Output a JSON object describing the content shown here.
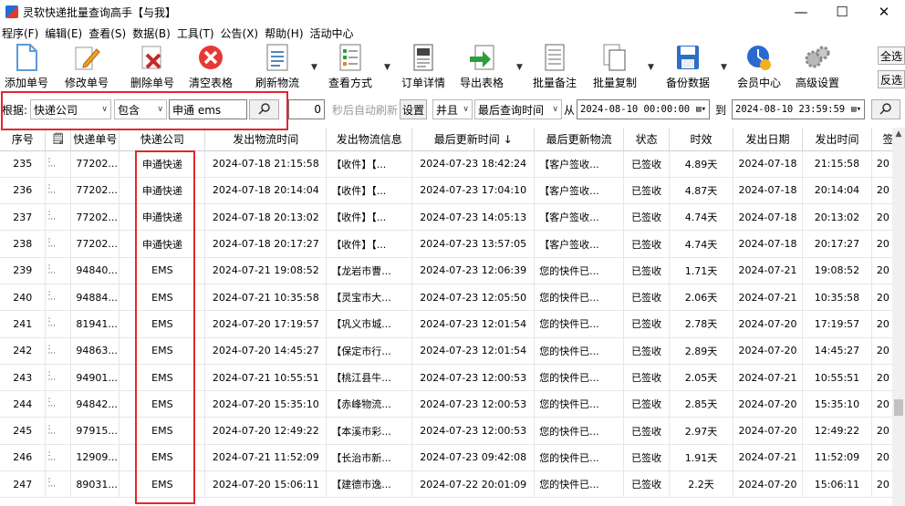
{
  "window": {
    "title": "灵软快递批量查询高手【与我】",
    "minimize": "—",
    "maximize": "☐",
    "close": "✕"
  },
  "menu": [
    "程序(F)",
    "编辑(E)",
    "查看(S)",
    "数据(B)",
    "工具(T)",
    "公告(X)",
    "帮助(H)",
    "活动中心"
  ],
  "toolbar": {
    "add": "添加单号",
    "edit": "修改单号",
    "delete": "删除单号",
    "clear": "清空表格",
    "refresh": "刷新物流",
    "view": "查看方式",
    "detail": "订单详情",
    "export": "导出表格",
    "remark": "批量备注",
    "copy": "批量复制",
    "backup": "备份数据",
    "member": "会员中心",
    "advanced": "高级设置",
    "select_all": "全选",
    "invert": "反选"
  },
  "filter": {
    "basis_label": "根据:",
    "field": "快递公司",
    "operator": "包含",
    "keyword": "申通 ems",
    "auto_refresh_value": "0",
    "auto_refresh_label": "秒后自动刷新",
    "settings": "设置",
    "logic": "并且",
    "time_field": "最后查询时间",
    "from_label": "从",
    "from": "2024-08-10 00:00:00",
    "to_label": "到",
    "to": "2024-08-10 23:59:59"
  },
  "table": {
    "columns": [
      "序号",
      "🗒",
      "快递单号",
      "快递公司",
      "发出物流时间",
      "发出物流信息",
      "最后更新时间 ↓",
      "最后更新物流",
      "状态",
      "时效",
      "发出日期",
      "发出时间",
      "签"
    ],
    "rows": [
      [
        "235",
        "77202...",
        "申通快递",
        "2024-07-18 21:15:58",
        "【收件】【...",
        "2024-07-23 18:42:24",
        "【客户签收...",
        "已签收",
        "4.89天",
        "2024-07-18",
        "21:15:58",
        "20"
      ],
      [
        "236",
        "77202...",
        "申通快递",
        "2024-07-18 20:14:04",
        "【收件】【...",
        "2024-07-23 17:04:10",
        "【客户签收...",
        "已签收",
        "4.87天",
        "2024-07-18",
        "20:14:04",
        "20"
      ],
      [
        "237",
        "77202...",
        "申通快递",
        "2024-07-18 20:13:02",
        "【收件】【...",
        "2024-07-23 14:05:13",
        "【客户签收...",
        "已签收",
        "4.74天",
        "2024-07-18",
        "20:13:02",
        "20"
      ],
      [
        "238",
        "77202...",
        "申通快递",
        "2024-07-18 20:17:27",
        "【收件】【...",
        "2024-07-23 13:57:05",
        "【客户签收...",
        "已签收",
        "4.74天",
        "2024-07-18",
        "20:17:27",
        "20"
      ],
      [
        "239",
        "94840...",
        "EMS",
        "2024-07-21 19:08:52",
        "【龙岩市曹...",
        "2024-07-23 12:06:39",
        "您的快件已...",
        "已签收",
        "1.71天",
        "2024-07-21",
        "19:08:52",
        "20"
      ],
      [
        "240",
        "94884...",
        "EMS",
        "2024-07-21 10:35:58",
        "【灵宝市大...",
        "2024-07-23 12:05:50",
        "您的快件已...",
        "已签收",
        "2.06天",
        "2024-07-21",
        "10:35:58",
        "20"
      ],
      [
        "241",
        "81941...",
        "EMS",
        "2024-07-20 17:19:57",
        "【巩义市城...",
        "2024-07-23 12:01:54",
        "您的快件已...",
        "已签收",
        "2.78天",
        "2024-07-20",
        "17:19:57",
        "20"
      ],
      [
        "242",
        "94863...",
        "EMS",
        "2024-07-20 14:45:27",
        "【保定市行...",
        "2024-07-23 12:01:54",
        "您的快件已...",
        "已签收",
        "2.89天",
        "2024-07-20",
        "14:45:27",
        "20"
      ],
      [
        "243",
        "94901...",
        "EMS",
        "2024-07-21 10:55:51",
        "【桃江县牛...",
        "2024-07-23 12:00:53",
        "您的快件已...",
        "已签收",
        "2.05天",
        "2024-07-21",
        "10:55:51",
        "20"
      ],
      [
        "244",
        "94842...",
        "EMS",
        "2024-07-20 15:35:10",
        "【赤峰物流...",
        "2024-07-23 12:00:53",
        "您的快件已...",
        "已签收",
        "2.85天",
        "2024-07-20",
        "15:35:10",
        "20"
      ],
      [
        "245",
        "97915...",
        "EMS",
        "2024-07-20 12:49:22",
        "【本溪市彩...",
        "2024-07-23 12:00:53",
        "您的快件已...",
        "已签收",
        "2.97天",
        "2024-07-20",
        "12:49:22",
        "20"
      ],
      [
        "246",
        "12909...",
        "EMS",
        "2024-07-21 11:52:09",
        "【长治市新...",
        "2024-07-23 09:42:08",
        "您的快件已...",
        "已签收",
        "1.91天",
        "2024-07-21",
        "11:52:09",
        "20"
      ],
      [
        "247",
        "89031...",
        "EMS",
        "2024-07-20 15:06:11",
        "【建德市逸...",
        "2024-07-22 20:01:09",
        "您的快件已...",
        "已签收",
        "2.2天",
        "2024-07-20",
        "15:06:11",
        "20"
      ]
    ]
  },
  "colors": {
    "highlight": "#e0282e",
    "add_icon": "#5b9bd5",
    "delete_icon": "#c62828",
    "clear_icon": "#e53935"
  }
}
